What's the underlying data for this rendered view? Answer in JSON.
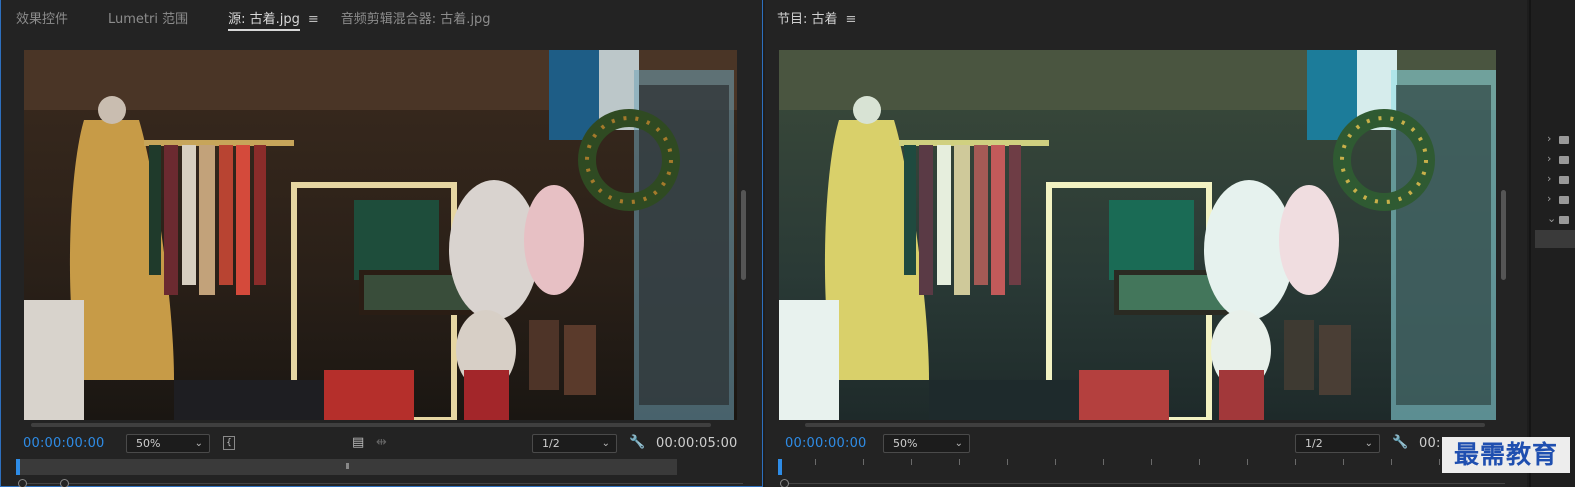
{
  "source_panel": {
    "tabs": [
      {
        "label": "效果控件",
        "active": false
      },
      {
        "label": "Lumetri 范围",
        "active": false
      },
      {
        "label": "源: 古着.jpg",
        "active": true
      },
      {
        "label": "音频剪辑混合器: 古着.jpg",
        "active": false
      }
    ],
    "menu_icon": "hamburger-icon",
    "timecode": "00:00:00:00",
    "zoom": "50%",
    "resolution": "1/2",
    "duration": "00:00:05:00",
    "accent_color": "#2e8ce6"
  },
  "program_panel": {
    "title": "节目: 古着",
    "menu_icon": "hamburger-icon",
    "timecode": "00:00:00:00",
    "zoom": "50%",
    "resolution": "1/2",
    "duration": "00:"
  },
  "project_tree": {
    "items": [
      {
        "icon": "chevron-right-icon"
      },
      {
        "icon": "chevron-right-icon"
      },
      {
        "icon": "chevron-right-icon"
      },
      {
        "icon": "chevron-right-icon"
      },
      {
        "icon": "chevron-down-icon"
      }
    ]
  },
  "watermark": {
    "text": "最需教育"
  },
  "colors": {
    "panel_bg": "#232323",
    "focus_border": "#2d6fbd",
    "timecode": "#2e8ce6"
  }
}
